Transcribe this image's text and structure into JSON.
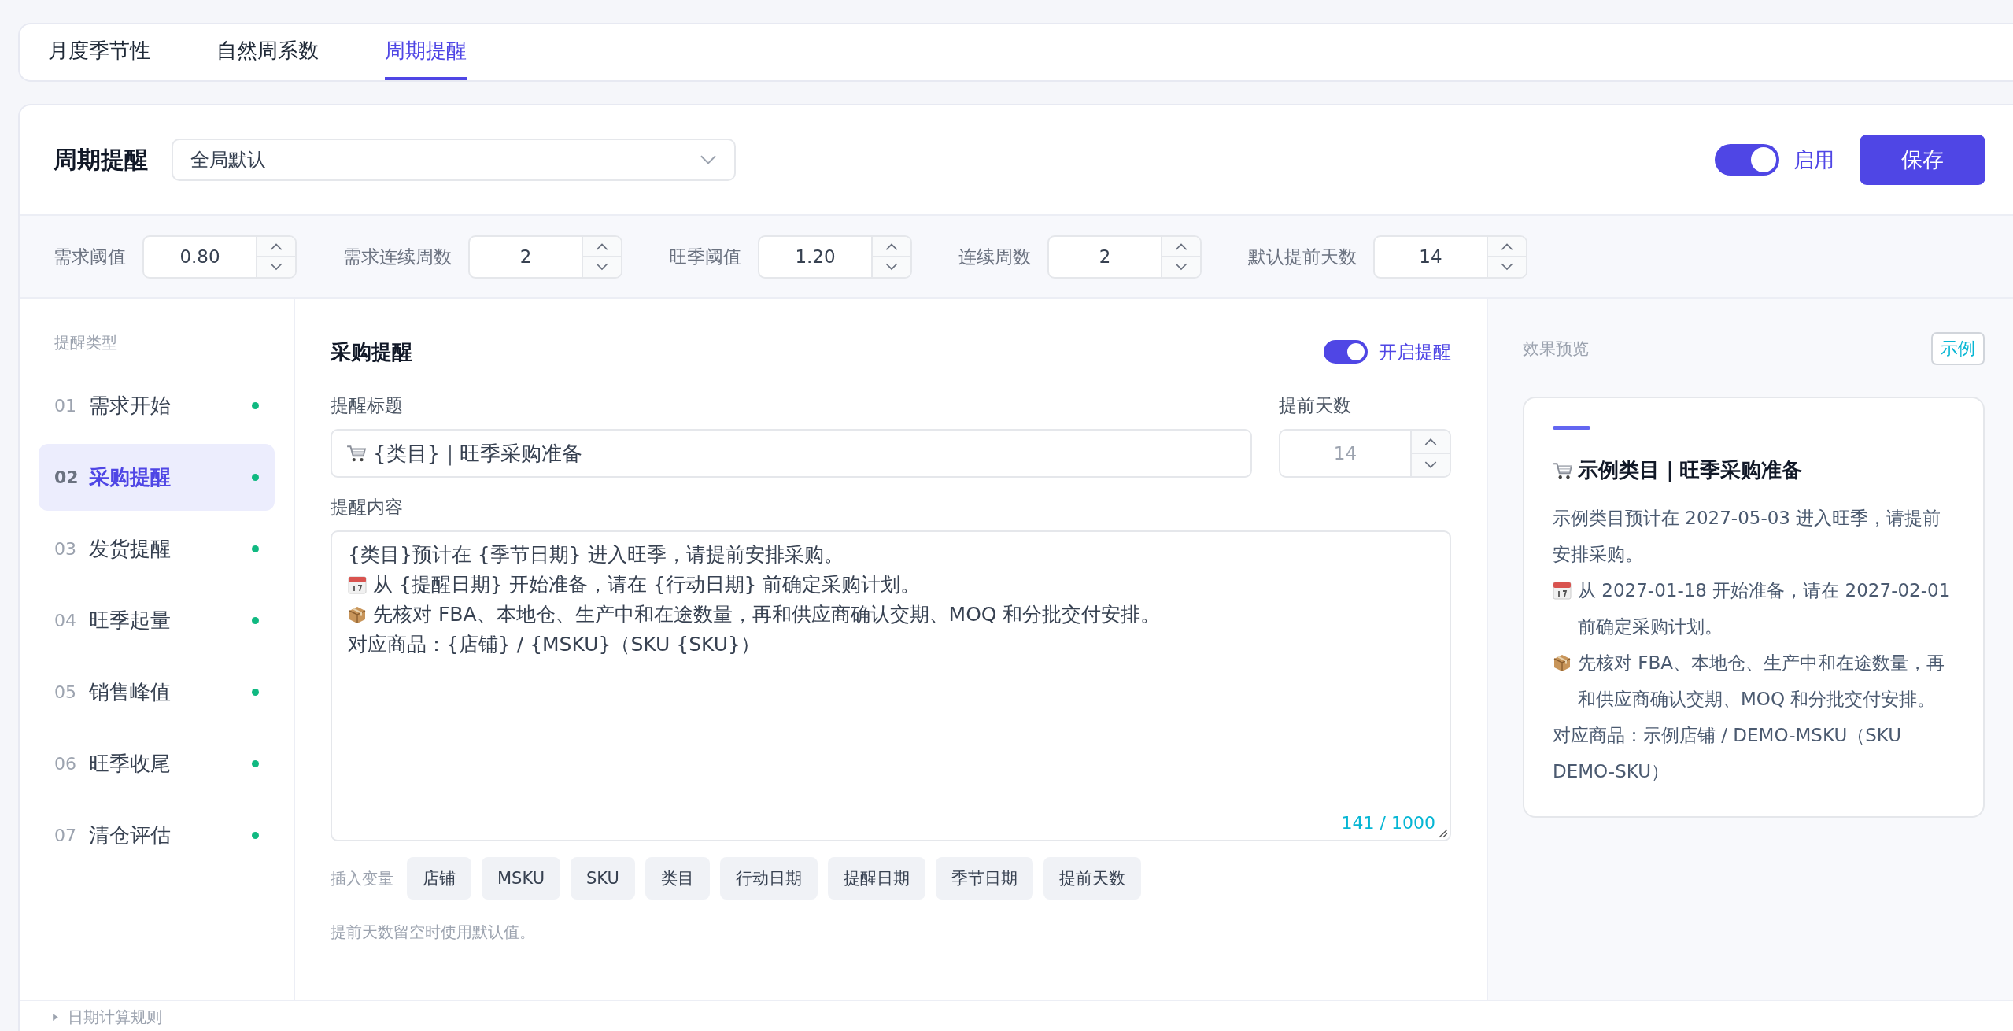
{
  "tabs": [
    {
      "label": "月度季节性",
      "selected": false
    },
    {
      "label": "自然周系数",
      "selected": false
    },
    {
      "label": "周期提醒",
      "selected": true
    }
  ],
  "header": {
    "title": "周期提醒",
    "scope_select": {
      "value": "全局默认"
    },
    "enable_toggle": {
      "on": true,
      "label": "启用"
    },
    "save_button": "保存"
  },
  "params": [
    {
      "label": "需求阈值",
      "value": "0.80"
    },
    {
      "label": "需求连续周数",
      "value": "2"
    },
    {
      "label": "旺季阈值",
      "value": "1.20"
    },
    {
      "label": "连续周数",
      "value": "2"
    },
    {
      "label": "默认提前天数",
      "value": "14"
    }
  ],
  "sidebar": {
    "title": "提醒类型",
    "items": [
      {
        "number": "01",
        "label": "需求开始",
        "selected": false,
        "enabled": true
      },
      {
        "number": "02",
        "label": "采购提醒",
        "selected": true,
        "enabled": true
      },
      {
        "number": "03",
        "label": "发货提醒",
        "selected": false,
        "enabled": true
      },
      {
        "number": "04",
        "label": "旺季起量",
        "selected": false,
        "enabled": true
      },
      {
        "number": "05",
        "label": "销售峰值",
        "selected": false,
        "enabled": true
      },
      {
        "number": "06",
        "label": "旺季收尾",
        "selected": false,
        "enabled": true
      },
      {
        "number": "07",
        "label": "清仓评估",
        "selected": false,
        "enabled": true
      }
    ]
  },
  "editor": {
    "title": "采购提醒",
    "reminder_toggle": {
      "on": true,
      "label": "开启提醒"
    },
    "title_field": {
      "label": "提醒标题",
      "value": "{类目}｜旺季采购准备"
    },
    "lead_days_field": {
      "label": "提前天数",
      "placeholder": "14"
    },
    "content_field": {
      "label": "提醒内容",
      "counter": "141 / 1000",
      "lines": [
        {
          "kind": "plain",
          "text": "{类目}预计在 {季节日期} 进入旺季，请提前安排采购。"
        },
        {
          "kind": "calendar",
          "text": "从 {提醒日期} 开始准备，请在 {行动日期} 前确定采购计划。"
        },
        {
          "kind": "package",
          "text": "先核对 FBA、本地仓、生产中和在途数量，再和供应商确认交期、MOQ 和分批交付安排。"
        },
        {
          "kind": "plain",
          "text": "对应商品：{店铺} / {MSKU}（SKU {SKU}）"
        }
      ]
    },
    "variables": {
      "label": "插入变量",
      "chips": [
        "店铺",
        "MSKU",
        "SKU",
        "类目",
        "行动日期",
        "提醒日期",
        "季节日期",
        "提前天数"
      ]
    },
    "hint": "提前天数留空时使用默认值。"
  },
  "preview": {
    "title": "效果预览",
    "badge": "示例",
    "card": {
      "title": "示例类目｜旺季采购准备",
      "lines": [
        {
          "kind": "plain",
          "text": "示例类目预计在 2027-05-03 进入旺季，请提前安排采购。"
        },
        {
          "kind": "calendar",
          "text": "从 2027-01-18 开始准备，请在 2027-02-01 前确定采购计划。"
        },
        {
          "kind": "package",
          "text": "先核对 FBA、本地仓、生产中和在途数量，再和供应商确认交期、MOQ 和分批交付安排。"
        },
        {
          "kind": "plain",
          "text": "对应商品：示例店铺 / DEMO-MSKU（SKU DEMO-SKU）"
        }
      ]
    }
  },
  "footer": {
    "label": "日期计算规则"
  }
}
